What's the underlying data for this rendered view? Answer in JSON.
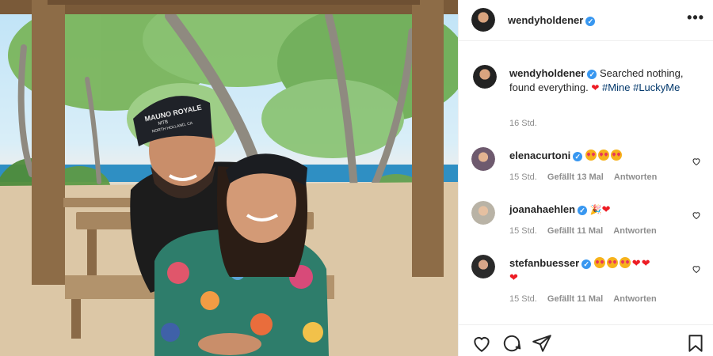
{
  "post": {
    "author": "wendyholdener",
    "caption_main": "Searched nothing, found everything.",
    "caption_tags": [
      "#Mine",
      "#LuckyMe"
    ],
    "time": "16 Std.",
    "photo_cap_text": [
      "MAUNO ROYALE",
      "MTB",
      "NORTH HOLLAND, CA"
    ]
  },
  "comments": [
    {
      "user": "elenacurtoni",
      "time": "15 Std.",
      "likes": "Gefällt 13 Mal",
      "reply": "Antworten",
      "emoji": [
        "heart-eyes",
        "heart-eyes",
        "heart-eyes"
      ]
    },
    {
      "user": "joanahaehlen",
      "time": "15 Std.",
      "likes": "Gefällt 11 Mal",
      "reply": "Antworten",
      "emoji": [
        "party-popper",
        "heart"
      ]
    },
    {
      "user": "stefanbuesser",
      "time": "15 Std.",
      "likes": "Gefällt 11 Mal",
      "reply": "Antworten",
      "emoji": [
        "heart-eyes",
        "heart-eyes",
        "heart-eyes",
        "heart",
        "heart",
        "heart"
      ]
    }
  ],
  "icons": {
    "more": "more-icon",
    "verified": "verified-badge-icon",
    "like": "heart-icon",
    "comment": "comment-icon",
    "share": "share-icon",
    "save": "bookmark-icon"
  },
  "colors": {
    "verified": "#3897f0",
    "tag": "#00376b",
    "meta": "#8e8e8e",
    "heart": "#ed1c24"
  }
}
